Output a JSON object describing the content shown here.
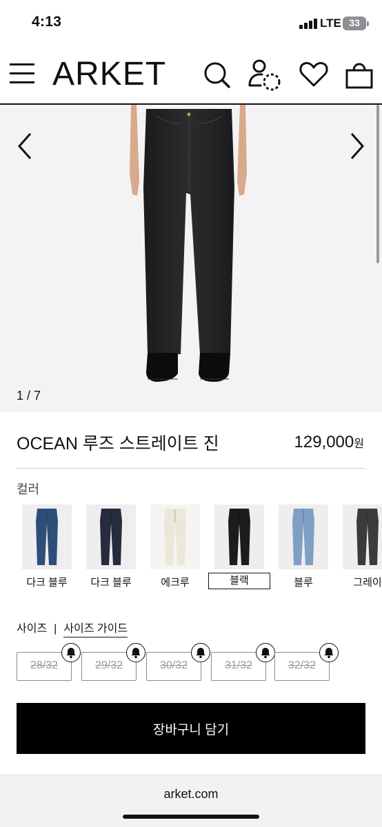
{
  "status": {
    "time": "4:13",
    "network": "LTE",
    "battery": "33"
  },
  "header": {
    "logo": "ARKET",
    "icons": [
      "menu-icon",
      "search-icon",
      "account-icon",
      "wishlist-heart-icon",
      "shopping-bag-icon"
    ]
  },
  "gallery": {
    "counter": "1 / 7"
  },
  "product": {
    "title": "OCEAN 루즈 스트레이트 진",
    "price": "129,000",
    "currency": "원"
  },
  "colors": {
    "label": "컬러",
    "items": [
      {
        "name": "다크 블루",
        "swatch": "#2e4e78",
        "bg": "#eeeeee"
      },
      {
        "name": "다크 블루",
        "swatch": "#262c3e",
        "bg": "#eeeeee"
      },
      {
        "name": "에크루",
        "swatch": "#ebe8d9",
        "bg": "#f4f4f2"
      },
      {
        "name": "블랙",
        "swatch": "#1c1c1e",
        "bg": "#eeeeee",
        "selected": true
      },
      {
        "name": "블루",
        "swatch": "#7f9fc4",
        "bg": "#eeeeee"
      },
      {
        "name": "그레이",
        "swatch": "#3b3b3d",
        "bg": "#eeeeee"
      }
    ]
  },
  "sizes": {
    "label": "사이즈",
    "separator": "|",
    "guide": "사이즈 가이드",
    "items": [
      "28/32",
      "29/32",
      "30/32",
      "31/32",
      "32/32"
    ]
  },
  "cart": {
    "label": "장바구니 담기"
  },
  "browser": {
    "url": "arket.com"
  }
}
